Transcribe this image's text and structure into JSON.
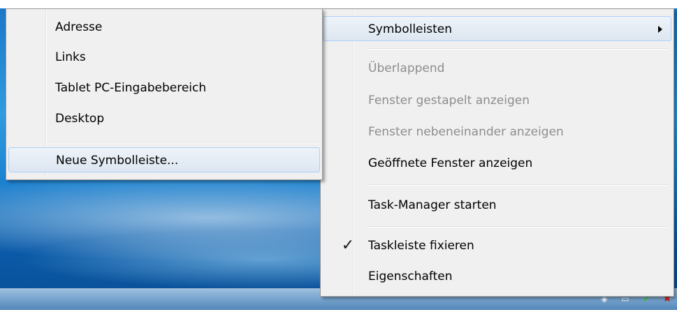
{
  "submenu": {
    "items": [
      {
        "label": "Adresse"
      },
      {
        "label": "Links"
      },
      {
        "label": "Tablet PC-Eingabebereich"
      },
      {
        "label": "Desktop"
      }
    ],
    "new_toolbar_label": "Neue Symbolleiste..."
  },
  "context_menu": {
    "toolbars_label": "Symbolleisten",
    "cascade_label": "Überlappend",
    "stacked_label": "Fenster gestapelt anzeigen",
    "side_by_side_label": "Fenster nebeneinander anzeigen",
    "show_open_windows_label": "Geöffnete Fenster anzeigen",
    "task_manager_label": "Task-Manager starten",
    "lock_taskbar_label": "Taskleiste fixieren",
    "lock_taskbar_checked": true,
    "properties_label": "Eigenschaften"
  },
  "icons": {
    "submenu_arrow": "chevron-right-icon",
    "checkmark": "checkmark-icon",
    "tray": [
      "network-icon",
      "display-icon",
      "shield-icon",
      "flag-icon"
    ]
  },
  "colors": {
    "menu_background": "#f0f0f0",
    "disabled_text": "#8d8d8d",
    "hover_border": "#aecff7"
  }
}
